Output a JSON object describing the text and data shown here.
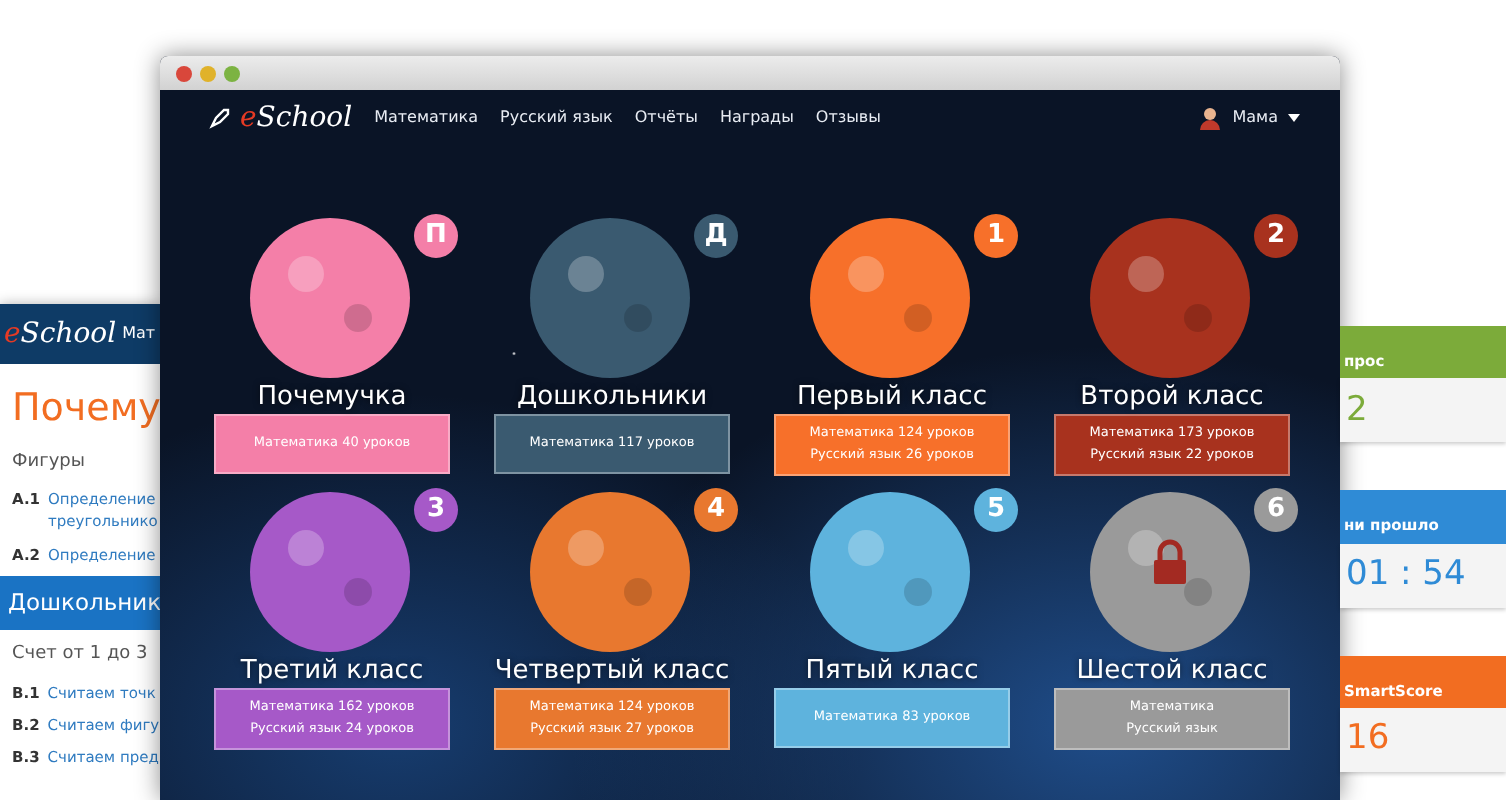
{
  "back_window": {
    "logo": {
      "accent": "e",
      "rest": "School"
    },
    "nav_link": "Мат",
    "heading": "Почему",
    "section": "Фигуры",
    "items": [
      {
        "code": "A.1",
        "text": "Определение треугольнико"
      },
      {
        "code": "A.2",
        "text": "Определение"
      }
    ],
    "band": "Дошкольник",
    "subsection": "Счет от 1 до 3",
    "items_2": [
      {
        "code": "B.1",
        "text": "Считаем точк"
      },
      {
        "code": "B.2",
        "text": "Считаем фигу"
      },
      {
        "code": "B.3",
        "text": "Считаем пред"
      }
    ]
  },
  "navbar": {
    "logo": {
      "accent": "e",
      "rest": "School"
    },
    "links": [
      "Математика",
      "Русский язык",
      "Отчёты",
      "Награды",
      "Отзывы"
    ],
    "user": "Мама"
  },
  "planets": [
    {
      "badge": "П",
      "name": "Почемучка",
      "lines": [
        "Математика 40 уроков"
      ],
      "color": "#f47fa8",
      "locked": false
    },
    {
      "badge": "Д",
      "name": "Дошкольники",
      "lines": [
        "Математика 117 уроков"
      ],
      "color": "#3a5a70",
      "locked": false
    },
    {
      "badge": "1",
      "name": "Первый класс",
      "lines": [
        "Математика 124 уроков",
        "Русский язык 26 уроков"
      ],
      "color": "#f7702a",
      "locked": false
    },
    {
      "badge": "2",
      "name": "Второй класс",
      "lines": [
        "Математика 173 уроков",
        "Русский язык 22 уроков"
      ],
      "color": "#a8321e",
      "locked": false
    },
    {
      "badge": "3",
      "name": "Третий класс",
      "lines": [
        "Математика 162 уроков",
        "Русский язык 24 уроков"
      ],
      "color": "#a659c8",
      "locked": false
    },
    {
      "badge": "4",
      "name": "Четвертый класс",
      "lines": [
        "Математика 124 уроков",
        "Русский язык 27 уроков"
      ],
      "color": "#e8782f",
      "locked": false
    },
    {
      "badge": "5",
      "name": "Пятый класс",
      "lines": [
        "Математика 83 уроков"
      ],
      "color": "#5eb3dd",
      "locked": false
    },
    {
      "badge": "6",
      "name": "Шестой класс",
      "lines": [
        "Математика",
        "Русский язык"
      ],
      "color": "#9a9a9a",
      "locked": true
    }
  ],
  "side_widgets": [
    {
      "title": "прос",
      "value": "2",
      "color": "#7cab3a"
    },
    {
      "title": "ни прошло",
      "value": "01 : 54",
      "color": "#2f8bd6"
    },
    {
      "title": "SmartScore",
      "value": "16",
      "color": "#f26d21"
    }
  ]
}
